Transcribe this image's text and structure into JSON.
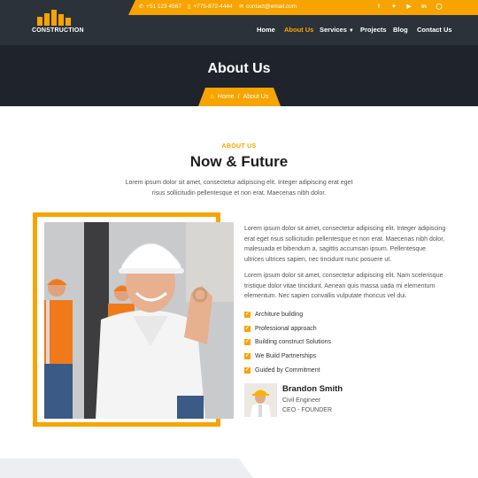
{
  "brand": {
    "logo_text": "CONSTRUCTION"
  },
  "topbar": {
    "phone_1": "+51 123 4567",
    "phone_2": "+775-872-4444",
    "email": "contact@email.com",
    "social": [
      "facebook-icon",
      "twitter-icon",
      "youtube-icon",
      "linkedin-icon",
      "instagram-icon"
    ]
  },
  "nav": {
    "items": [
      "Home",
      "About Us",
      "Services",
      "Projects",
      "Blog",
      "Contact Us"
    ],
    "active": "About Us"
  },
  "banner": {
    "title": "About Us",
    "breadcrumb": {
      "home": "Home",
      "separator": "/",
      "current": "About Us"
    }
  },
  "section": {
    "kicker": "ABOUT US",
    "title": "Now & Future",
    "description": "Lorem ipsum dolor sit amet, consectetur adipiscing elit. Integer adipiscing erat eget risus sollicitudin pellentesque et non erat. Maecenas nibh dolor."
  },
  "content": {
    "paragraph_1": "Lorem ipsum dolor sit amet, consectetur adipiscing elit. Integer adipiscing erat eget risus sollicitudin pellentesque et non erat. Maecenas nibh dolor, malesuada et bibendum a, sagittis accumsan ipsum. Pellentesque ultrices ultrices sapien, nec tincidunt nunc posuere ut.",
    "paragraph_2": "Lorem ipsum dolor sit amet, consectetur adipiscing elit. Nam scelerisque tristique dolor vitae tincidunt. Aenean quis massa uada mi elementum elementum. Nec sapien convallis vulputate rhoncus vel dui.",
    "checklist": [
      "Architure building",
      "Professional approach",
      "Building construct Solutions",
      "We Build Partnerships",
      "Guided by Commitment"
    ]
  },
  "author": {
    "name": "Brandon Smith",
    "role": "Civil Engineer",
    "company": "CEO - FOUNDER"
  },
  "colors": {
    "accent": "#f8a400",
    "header_bg": "#2c323a",
    "banner_bg": "#1f242c"
  }
}
